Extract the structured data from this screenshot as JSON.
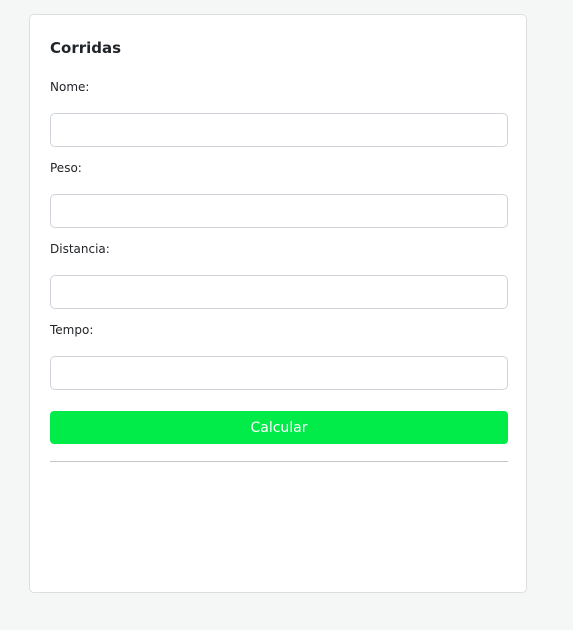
{
  "card": {
    "title": "Corridas"
  },
  "form": {
    "fields": [
      {
        "label": "Nome:",
        "value": ""
      },
      {
        "label": "Peso:",
        "value": ""
      },
      {
        "label": "Distancia:",
        "value": ""
      },
      {
        "label": "Tempo:",
        "value": ""
      }
    ],
    "submit_label": "Calcular"
  },
  "colors": {
    "button": "#02ec49",
    "background": "#f5f6f6",
    "card_border": "#dcdfe2"
  }
}
